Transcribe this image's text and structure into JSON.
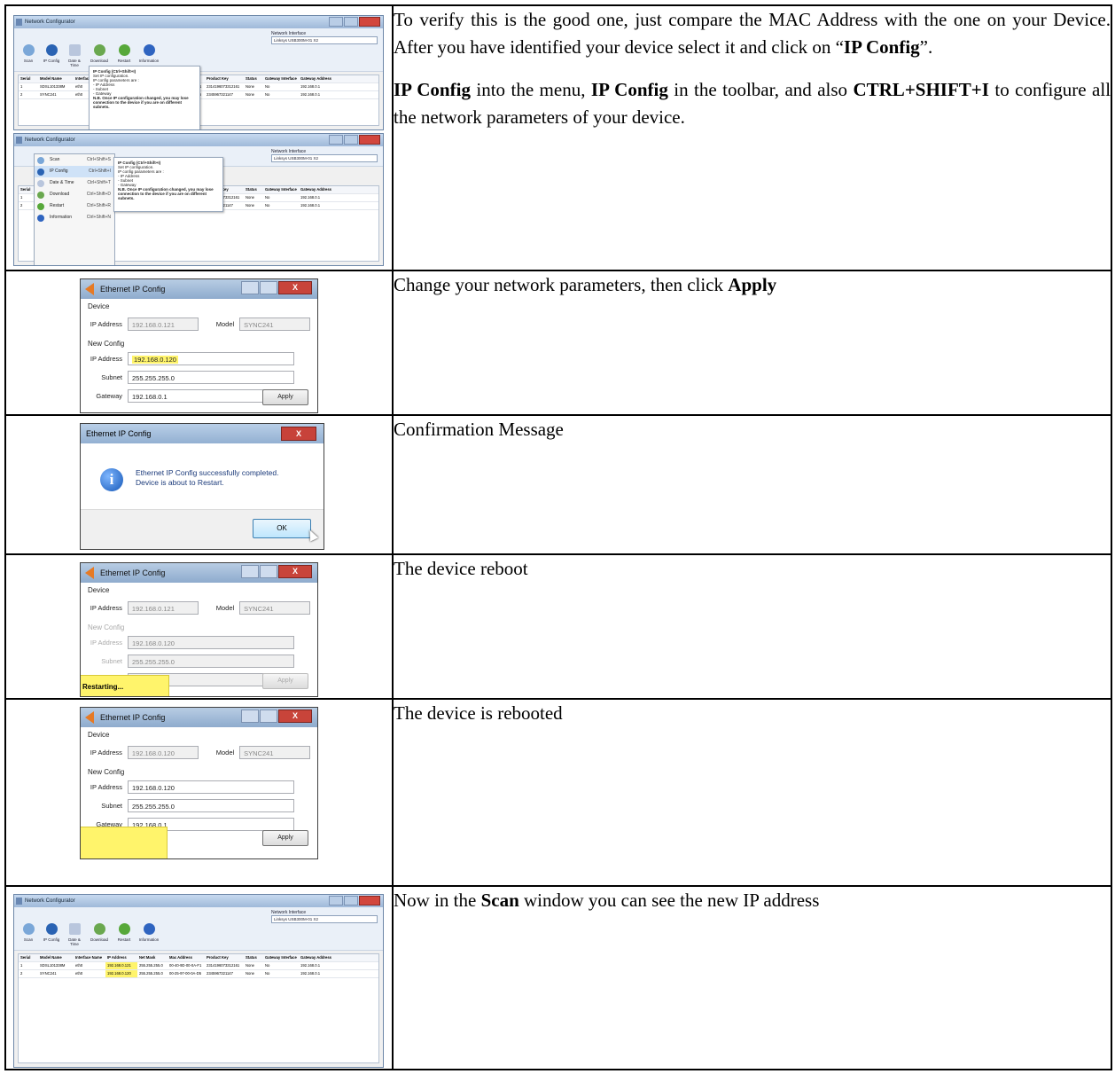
{
  "rows": [
    {
      "paragraphs": [
        [
          {
            "t": "To verify this is the good one, just compare the MAC Address with the one on your Device.  After you have identified your device select it and click on “"
          },
          {
            "t": "IP Config",
            "b": true
          },
          {
            "t": "”."
          }
        ],
        [
          {
            "t": "IP Config",
            "b": true
          },
          {
            "t": " into the menu, "
          },
          {
            "t": "IP Config",
            "b": true
          },
          {
            "t": " in the toolbar, and also "
          },
          {
            "t": "CTRL+SHIFT+I",
            "b": true
          },
          {
            "t": " to configure all the network parameters of your device."
          }
        ]
      ]
    },
    {
      "paragraphs": [
        [
          {
            "t": "Change your network parameters, then click "
          },
          {
            "t": "Apply",
            "b": true
          }
        ]
      ]
    },
    {
      "paragraphs": [
        [
          {
            "t": "Confirmation Message"
          }
        ]
      ]
    },
    {
      "paragraphs": [
        [
          {
            "t": "The device reboot"
          }
        ]
      ]
    },
    {
      "paragraphs": [
        [
          {
            "t": "The device is rebooted"
          }
        ]
      ]
    },
    {
      "paragraphs": [
        [
          {
            "t": "Now in the "
          },
          {
            "t": "Scan",
            "b": true
          },
          {
            "t": " window you can see the new IP address"
          }
        ]
      ]
    }
  ],
  "netconfig": {
    "title": "Network Configurator",
    "net_label": "Network Interface",
    "net_value": "Linksys USB300M-01 X2",
    "toolbar": [
      "Scan",
      "IP Config",
      "Date & Time",
      "Download",
      "Restart",
      "Information"
    ],
    "columns": [
      "Serial",
      "Model Name",
      "Interface Name",
      "IP Address",
      "Net Mask",
      "Mac Address",
      "Product Key",
      "Status",
      "Gateway Interface",
      "Gateway Address"
    ],
    "rows_before": [
      [
        "1",
        "SDSL101338M",
        "eth0",
        "192.168.0.121",
        "255.255.255.0",
        "00-40-9D-00-0A-F1",
        "2314196073312161",
        "None",
        "No",
        "192.168.0.1"
      ],
      [
        "2",
        "SYNC241",
        "eth0",
        "192.168.0.122",
        "255.255.255.0",
        "00-25-97-00-0A-D5",
        "2345967321147",
        "None",
        "No",
        "192.168.0.1"
      ]
    ],
    "rows_after": [
      [
        "1",
        "SDSL101338M",
        "eth0",
        "192.168.0.121",
        "255.255.255.0",
        "00-40-9D-00-0A-F1",
        "2314196073312161",
        "None",
        "No",
        "192.168.0.1"
      ],
      [
        "2",
        "SYNC241",
        "eth0",
        "192.168.0.120",
        "255.255.255.0",
        "00-25-97-00-0A-D5",
        "2345967321147",
        "None",
        "No",
        "192.168.0.1"
      ]
    ],
    "tooltip_title": "IP Config (Ctrl+Shift+I)",
    "tooltip_lines": [
      "Set IP configuration.",
      "IP config parameters are :",
      "- IP Address",
      "- Subnet",
      "- Gateway",
      "N.B. Once IP configuration changed, you may lose connection to the device if you are on different subnets."
    ],
    "menu": [
      {
        "label": "Scan",
        "shortcut": "Ctrl+Shift+S"
      },
      {
        "label": "IP Config",
        "shortcut": "Ctrl+Shift+I"
      },
      {
        "label": "Date & Time",
        "shortcut": "Ctrl+Shift+T"
      },
      {
        "label": "Download",
        "shortcut": "Ctrl+Shift+D"
      },
      {
        "label": "Restart",
        "shortcut": "Ctrl+Shift+R"
      },
      {
        "label": "Information",
        "shortcut": "Ctrl+Shift+N"
      }
    ]
  },
  "ipdialog": {
    "title": "Ethernet IP Config",
    "device_label": "Device",
    "ip_label": "IP Address",
    "model_label": "Model",
    "model_value": "SYNC241",
    "newconfig_label": "New Config",
    "subnet_label": "Subnet",
    "gateway_label": "Gateway",
    "apply_label": "Apply",
    "close_label": "X",
    "restarting_label": "Restarting...",
    "d1": {
      "device_ip": "192.168.0.121",
      "ip": "192.168.0.120",
      "subnet": "255.255.255.0",
      "gateway": "192.168.0.1"
    },
    "d2": {
      "device_ip": "192.168.0.121",
      "ip": "192.168.0.120",
      "subnet": "255.255.255.0",
      "gateway": "192.168.0.1"
    },
    "d3": {
      "device_ip": "192.168.0.120",
      "ip": "192.168.0.120",
      "subnet": "255.255.255.0",
      "gateway": "192.168.0.1"
    }
  },
  "message": {
    "title": "Ethernet IP Config",
    "close_label": "X",
    "line1": "Ethernet IP Config successfully completed.",
    "line2": "Device is about to Restart.",
    "ok_label": "OK",
    "info_glyph": "i"
  },
  "colors": {
    "highlight": "#fff46b",
    "title_gradient": "#9fb9d9",
    "close_red": "#c8443a"
  }
}
